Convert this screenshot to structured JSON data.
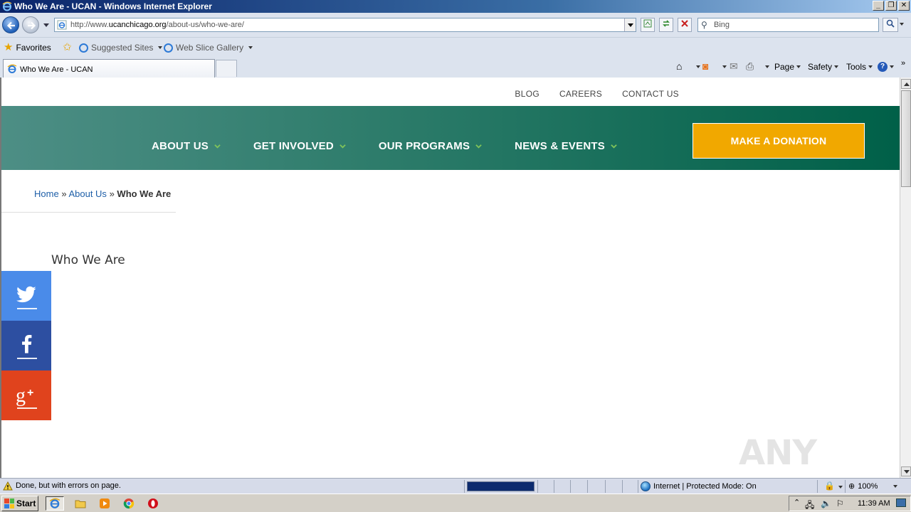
{
  "window": {
    "title": "Who We Are - UCAN - Windows Internet Explorer"
  },
  "address_bar": {
    "url_prefix": "http://www.",
    "url_domain": "ucanchicago.org",
    "url_path": "/about-us/who-we-are/",
    "search_placeholder": "Bing"
  },
  "favorites_bar": {
    "favorites_label": "Favorites",
    "suggested_sites_label": "Suggested Sites",
    "web_slice_label": "Web Slice Gallery"
  },
  "tabs": [
    {
      "title": "Who We Are - UCAN"
    }
  ],
  "command_bar": {
    "page_label": "Page",
    "safety_label": "Safety",
    "tools_label": "Tools"
  },
  "site": {
    "top_links": [
      "BLOG",
      "CAREERS",
      "CONTACT US"
    ],
    "nav": [
      "ABOUT US",
      "GET INVOLVED",
      "OUR PROGRAMS",
      "NEWS & EVENTS"
    ],
    "donate_label": "MAKE A DONATION",
    "breadcrumb": {
      "home": "Home",
      "sep": "»",
      "about": "About Us",
      "current": "Who We Are"
    },
    "page_title": "Who We Are",
    "watermark": "ANY RUN",
    "colors": {
      "nav_green_dark": "#006048",
      "nav_green_light": "#4d8e85",
      "donate": "#f1a800",
      "twitter": "#4a8be9",
      "facebook": "#2d4fa1",
      "google_plus": "#e0431d",
      "link": "#1e5fa8"
    }
  },
  "status_bar": {
    "message": "Done, but with errors on page.",
    "zone": "Internet | Protected Mode: On",
    "zoom": "100%"
  },
  "taskbar": {
    "start_label": "Start",
    "clock": "11:39 AM"
  }
}
